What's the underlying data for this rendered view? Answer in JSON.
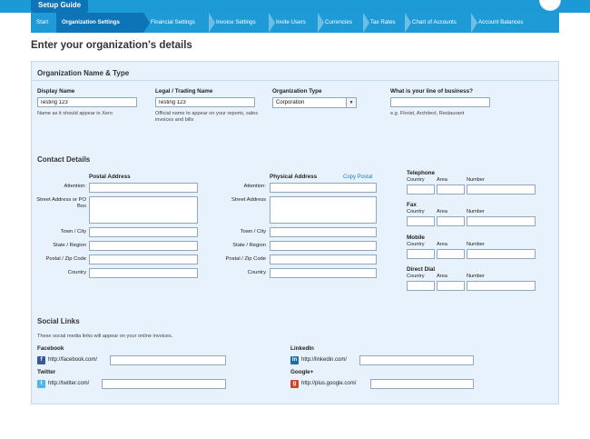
{
  "topbar": {
    "tab_label": "Setup Guide"
  },
  "steps": [
    "Start",
    "Organization Settings",
    "Financial Settings",
    "Invoice Settings",
    "Invite Users",
    "Currencies",
    "Tax Rates",
    "Chart of Accounts",
    "Account Balances"
  ],
  "page_title": "Enter your organization's details",
  "org": {
    "section_title": "Organization Name & Type",
    "display_name_label": "Display Name",
    "display_name_value": "Testing 123",
    "display_name_note": "Name as it should appear in Xero",
    "legal_name_label": "Legal / Trading Name",
    "legal_name_value": "Testing 123",
    "legal_name_note": "Official name to appear on your reports, sales invoices and bills",
    "org_type_label": "Organization Type",
    "org_type_value": "Corporation",
    "business_label": "What is your line of business?",
    "business_value": "",
    "business_note": "e.g. Florist, Architect, Restaurant"
  },
  "contact": {
    "section_title": "Contact Details",
    "postal_heading": "Postal Address",
    "physical_heading": "Physical Address",
    "copy_postal": "Copy Postal",
    "labels": {
      "attention": "Attention:",
      "street": "Street Address or PO Box",
      "street_short": "Street Address",
      "town": "Town / City",
      "state": "State / Region",
      "zip": "Postal / Zip Code",
      "country": "Country"
    },
    "phone_groups": [
      "Telephone",
      "Fax",
      "Mobile",
      "Direct Dial"
    ],
    "phone_cols": {
      "country": "Country",
      "area": "Area",
      "number": "Number"
    }
  },
  "social": {
    "section_title": "Social Links",
    "note": "These social media links will appear on your online invoices.",
    "facebook_label": "Facebook",
    "facebook_prefix": "http://facebook.com/",
    "twitter_label": "Twitter",
    "twitter_prefix": "http://twitter.com/",
    "linkedin_label": "LinkedIn",
    "linkedin_prefix": "http://linkedin.com/",
    "google_label": "Google+",
    "google_prefix": "http://plus.google.com/"
  },
  "colors": {
    "accent": "#1b9ad6",
    "active_step": "#0e74b8",
    "panel_bg": "#e8f2fd",
    "link": "#1e7bc0"
  }
}
